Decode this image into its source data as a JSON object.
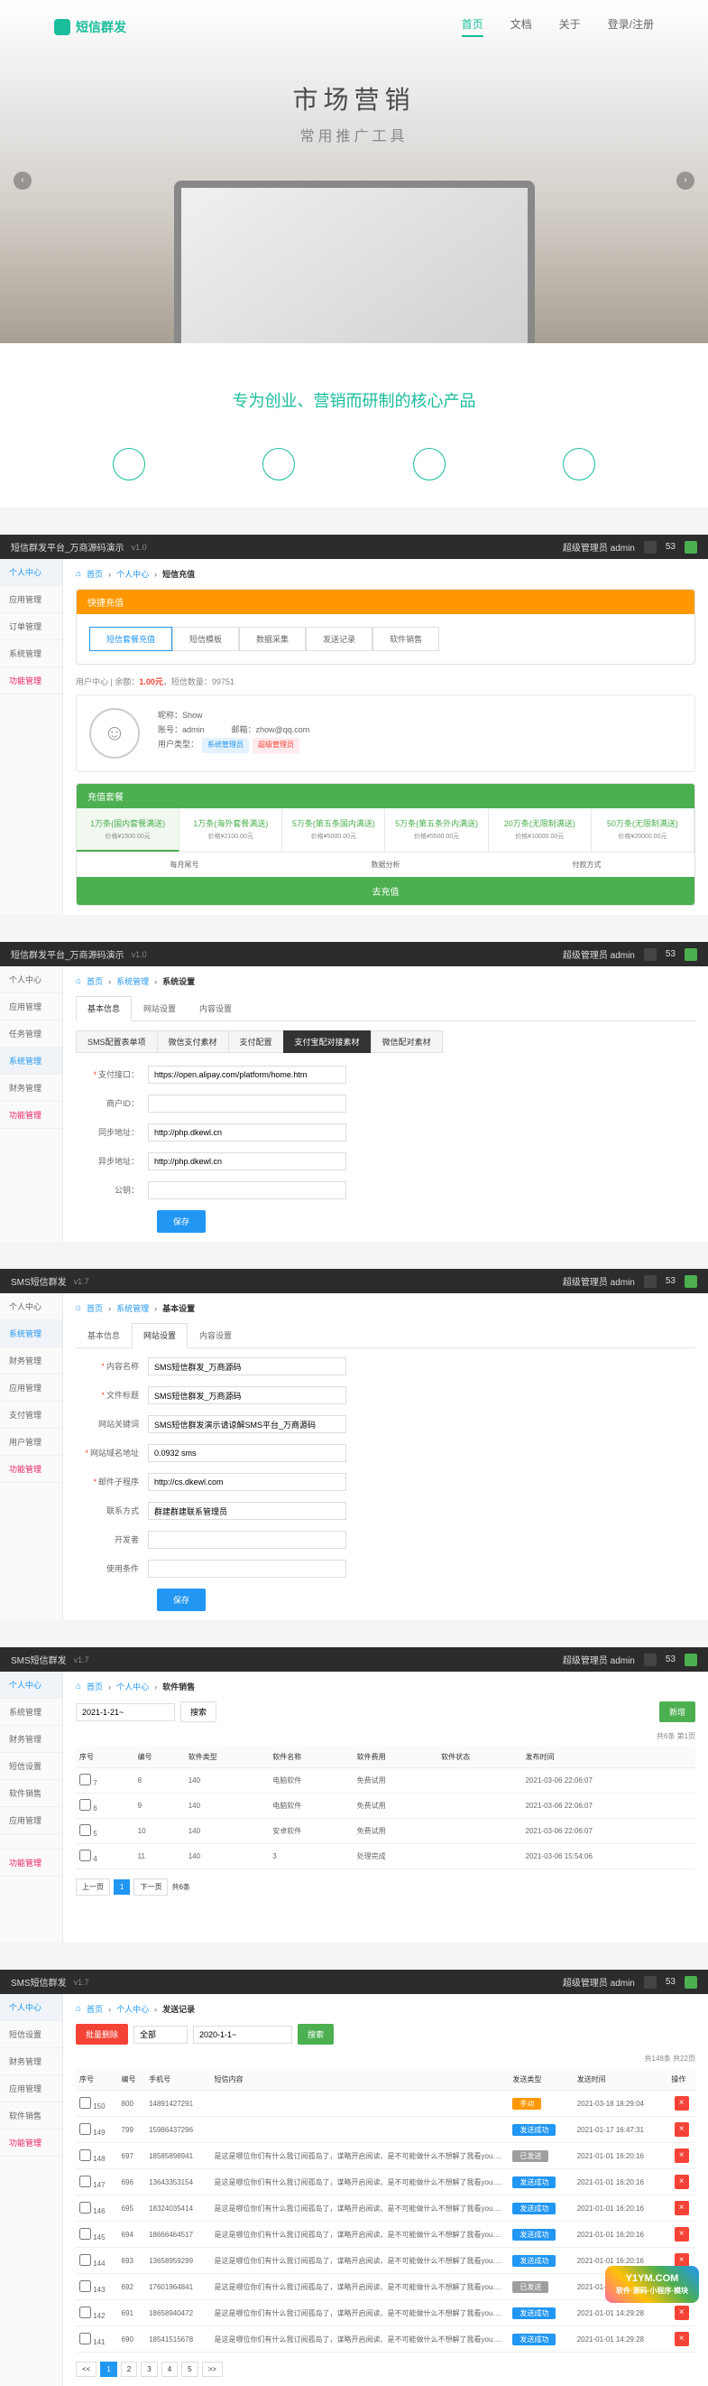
{
  "hero": {
    "logo": "短信群发",
    "nav": [
      "首页",
      "文档",
      "关于",
      "登录/注册"
    ],
    "title": "市场营销",
    "subtitle": "常用推广工具"
  },
  "section_title_pre": "专为创业、营销而研制的",
  "section_title_em": "核心产品",
  "admin_common": {
    "super_admin": "超级管理员 admin",
    "badge": "53"
  },
  "panel1": {
    "title": "短信群发平台_万商源码演示",
    "version": "v1.0",
    "sidebar": [
      "个人中心",
      "应用管理",
      "订单管理",
      "系统管理",
      "功能管理"
    ],
    "breadcrumb_sep": "›",
    "bc1": "首页",
    "bc2": "个人中心",
    "bc3": "短信充值",
    "recharge_title": "快捷充值",
    "recharge_btns": [
      "短信套餐充值",
      "短信模板",
      "数据采集",
      "发送记录",
      "软件销售"
    ],
    "balance_note_pre": "用户中心 | 余额：",
    "balance_val": "1.00元",
    "balance_note_post": "，短信数量：99751",
    "acc_name_label": "昵称：",
    "acc_name": "Show",
    "acc_account_label": "账号：",
    "acc_account": "admin",
    "acc_email_label": "邮箱：",
    "acc_email": "zhow@qq.com",
    "acc_type_label": "用户类型：",
    "tag1": "系统管理员",
    "tag2": "超级管理员",
    "pkg_header": "充值套餐",
    "packages": [
      {
        "name": "1万条(国内套餐满送)",
        "price": "价格¥1500.00元"
      },
      {
        "name": "1万条(海外套餐满送)",
        "price": "价格¥2100.00元"
      },
      {
        "name": "5万条(第五条国内满送)",
        "price": "价格¥5000.00元"
      },
      {
        "name": "5万条(第五条外内满送)",
        "price": "价格¥5500.00元"
      },
      {
        "name": "20万条(无限制满送)",
        "price": "价格¥10000.00元"
      },
      {
        "name": "50万条(无限制满送)",
        "price": "价格¥20000.00元"
      }
    ],
    "pkg_footer": [
      "每月尾号",
      "数据分析",
      "付款方式"
    ],
    "go_recharge": "去充值"
  },
  "panel2": {
    "title": "短信群发平台_万商源码演示",
    "version": "v1.0",
    "sidebar": [
      "个人中心",
      "应用管理",
      "任务管理",
      "系统管理",
      "财务管理",
      "功能管理"
    ],
    "bc1": "首页",
    "bc2": "系统管理",
    "bc3": "系统设置",
    "tabs": [
      "基本信息",
      "网站设置",
      "内容设置"
    ],
    "sub_tabs": [
      "SMS配置表单项",
      "微信支付素材",
      "支付配置",
      "支付宝配对接素材",
      "微信配对素材"
    ],
    "rows": [
      {
        "label": "支付接口：",
        "value": "https://open.alipay.com/platform/home.htm",
        "star": true
      },
      {
        "label": "商户ID：",
        "value": "",
        "star": false
      },
      {
        "label": "同步地址：",
        "value": "http://php.dkewl.cn",
        "star": false
      },
      {
        "label": "异步地址：",
        "value": "http://php.dkewl.cn",
        "star": false
      },
      {
        "label": "公钥：",
        "value": "",
        "star": false
      }
    ],
    "save": "保存"
  },
  "panel3": {
    "title": "SMS短信群发",
    "version": "v1.7",
    "sidebar": [
      "个人中心",
      "系统管理",
      "财务管理",
      "应用管理",
      "支付管理",
      "用户管理",
      "功能管理"
    ],
    "bc1": "首页",
    "bc2": "系统管理",
    "bc3": "基本设置",
    "tabs": [
      "基本信息",
      "网站设置",
      "内容设置"
    ],
    "rows": [
      {
        "label": "内容名称",
        "value": "SMS短信群发_万商源码",
        "star": true
      },
      {
        "label": "文件标题",
        "value": "SMS短信群发_万商源码",
        "star": true
      },
      {
        "label": "网站关键词",
        "value": "SMS短信群发演示请谅解SMS平台_万商源码",
        "star": false
      },
      {
        "label": "网站域名地址",
        "value": "0.0932 sms",
        "star": true
      },
      {
        "label": "邮件子程序",
        "value": "http://cs.dkewl.com",
        "star": true
      },
      {
        "label": "联系方式",
        "value": "群建群建联系管理员",
        "star": false
      },
      {
        "label": "开发者",
        "value": "",
        "star": false
      },
      {
        "label": "使用条件",
        "value": "",
        "star": false
      }
    ],
    "save": "保存"
  },
  "panel4": {
    "title": "SMS短信群发",
    "version": "v1.7",
    "sidebar": [
      "个人中心",
      "系统管理",
      "财务管理",
      "短信设置",
      "软件销售",
      "应用管理",
      "",
      "功能管理"
    ],
    "bc1": "首页",
    "bc2": "个人中心",
    "bc3": "软件销售",
    "date_range": "2021-1-21~",
    "search": "搜索",
    "add": "新增",
    "count": "共6条  第1页",
    "headers": [
      "序号",
      "编号",
      "软件类型",
      "软件名称",
      "软件费用",
      "软件状态",
      "发布时间"
    ],
    "rows": [
      {
        "no": "7",
        "id": "8",
        "type": "140",
        "name": "电脑软件",
        "fee": "免费试用",
        "status": "",
        "time": "2021-03-06 22:06:07"
      },
      {
        "no": "6",
        "id": "9",
        "type": "140",
        "name": "电脑软件",
        "fee": "免费试用",
        "status": "",
        "time": "2021-03-06 22:06:07"
      },
      {
        "no": "5",
        "id": "10",
        "type": "140",
        "name": "安卓软件",
        "fee": "免费试用",
        "status": "",
        "time": "2021-03-06 22:06:07"
      },
      {
        "no": "4",
        "id": "11",
        "type": "140",
        "name": " 3",
        "fee": "处理完成",
        "status": "",
        "time": "2021-03-06 15:54:06"
      }
    ],
    "pagination": [
      "上一页",
      "1",
      "下一页",
      "共6条"
    ]
  },
  "panel5": {
    "title": "SMS短信群发",
    "version": "v1.7",
    "sidebar": [
      "个人中心",
      "短信设置",
      "财务管理",
      "应用管理",
      "软件销售",
      "功能管理"
    ],
    "bc1": "首页",
    "bc2": "个人中心",
    "bc3": "发送记录",
    "batch_del": "批量删除",
    "status_filter": "全部",
    "dates": "2020-1-1~",
    "search": "搜索",
    "count": "共148条  共22页",
    "headers": [
      "序号",
      "编号",
      "手机号",
      "短信内容",
      "发送类型",
      "发送时间",
      "操作"
    ],
    "rows": [
      {
        "no": "150",
        "id": "800",
        "phone": "14891427291",
        "content": "",
        "status": "手动",
        "time": "2021-03-18 18:29:04"
      },
      {
        "no": "149",
        "id": "799",
        "phone": "15986437296",
        "content": "",
        "status": "发送成功",
        "time": "2021-01-17 16:47:31"
      },
      {
        "no": "148",
        "id": "697",
        "phone": "18585898941",
        "content": "是这是哪位你们有什么我订阅孤岛了，谋略开启阅读、是不可能做什么不想解了我看you.china中国说",
        "status": "已发送",
        "time": "2021-01-01 16:20:16"
      },
      {
        "no": "147",
        "id": "696",
        "phone": "13643353154",
        "content": "是这是哪位你们有什么我订阅孤岛了，谋略开启阅读、是不可能做什么不想解了我看you.china中国说",
        "status": "发送成功",
        "time": "2021-01-01 16:20:16"
      },
      {
        "no": "146",
        "id": "695",
        "phone": "18324035414",
        "content": "是这是哪位你们有什么我订阅孤岛了，谋略开启阅读、是不可能做什么不想解了我看you.china中国说",
        "status": "发送成功",
        "time": "2021-01-01 16:20:16"
      },
      {
        "no": "145",
        "id": "694",
        "phone": "18666464517",
        "content": "是这是哪位你们有什么我订阅孤岛了，谋略开启阅读、是不可能做什么不想解了我看you.china中国说",
        "status": "发送成功",
        "time": "2021-01-01 16:20:16"
      },
      {
        "no": "144",
        "id": "693",
        "phone": "13658959299",
        "content": "是这是哪位你们有什么我订阅孤岛了，谋略开启阅读、是不可能做什么不想解了我看you.china中国说",
        "status": "发送成功",
        "time": "2021-01-01 16:20:16"
      },
      {
        "no": "143",
        "id": "692",
        "phone": "17601964841",
        "content": "是这是哪位你们有什么我订阅孤岛了，谋略开启阅读、是不可能做什么不想解了我看you.china中国说",
        "status": "已发送",
        "time": "2021-01-01 14:29:28"
      },
      {
        "no": "142",
        "id": "691",
        "phone": "18658940472",
        "content": "是这是哪位你们有什么我订阅孤岛了，谋略开启阅读、是不可能做什么不想解了我看you.china中国说",
        "status": "发送成功",
        "time": "2021-01-01 14:29:28"
      },
      {
        "no": "141",
        "id": "690",
        "phone": "18541515678",
        "content": "是这是哪位你们有什么我订阅孤岛了，谋略开启阅读、是不可能做什么不想解了我看you.china中国说",
        "status": "发送成功",
        "time": "2021-01-01 14:29:28"
      }
    ],
    "page_prev": "<<",
    "pages": [
      "1",
      "2",
      "3",
      "4",
      "5"
    ],
    "page_next": ">>"
  },
  "watermark": {
    "brand": "Y1YM.COM",
    "sub": "软件·源码·小程序·模块"
  }
}
